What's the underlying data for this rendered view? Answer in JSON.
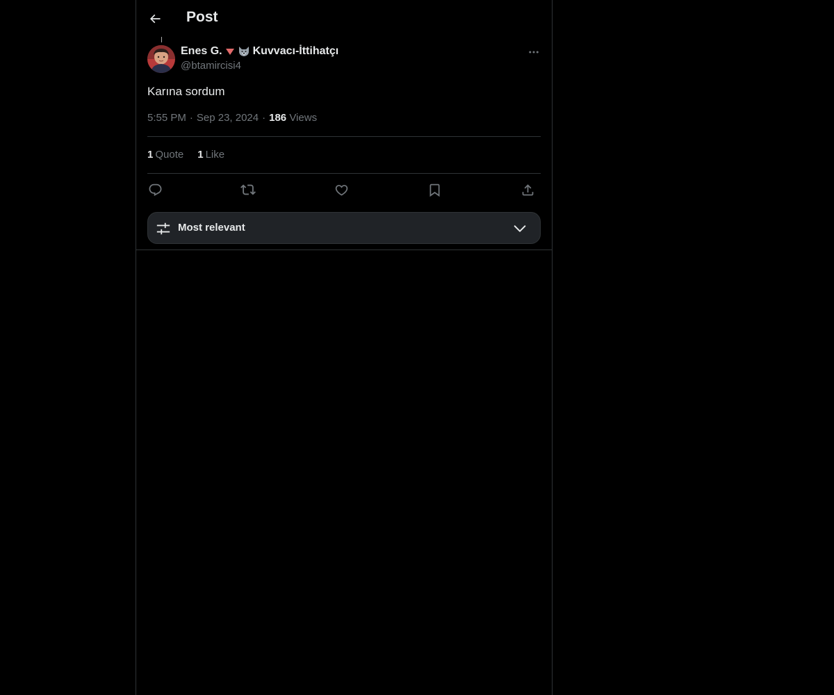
{
  "header": {
    "title": "Post",
    "back_icon": "arrow-left-icon"
  },
  "post": {
    "author": {
      "display_name_part1": "Enes G.",
      "display_name_part2": "Kuvvacı-İttihatçı",
      "emojis": [
        "red-triangle-down-icon",
        "wolf-face-icon"
      ],
      "handle": "@btamircisi4"
    },
    "text": "Karına sordum",
    "time": "5:55 PM",
    "separator": "·",
    "date": "Sep 23, 2024",
    "views_count": "186",
    "views_label": "Views"
  },
  "stats": {
    "quotes_count": "1",
    "quotes_label": "Quote",
    "likes_count": "1",
    "likes_label": "Like"
  },
  "actions": [
    "reply-icon",
    "repost-icon",
    "like-icon",
    "bookmark-icon",
    "share-icon"
  ],
  "sort": {
    "label": "Most relevant",
    "icon": "sliders-icon",
    "chevron": "chevron-down-icon"
  },
  "colors": {
    "background": "#000000",
    "border": "#2f3336",
    "text_primary": "#e7e9ea",
    "text_secondary": "#71767b",
    "sort_bar_bg": "#202327"
  }
}
